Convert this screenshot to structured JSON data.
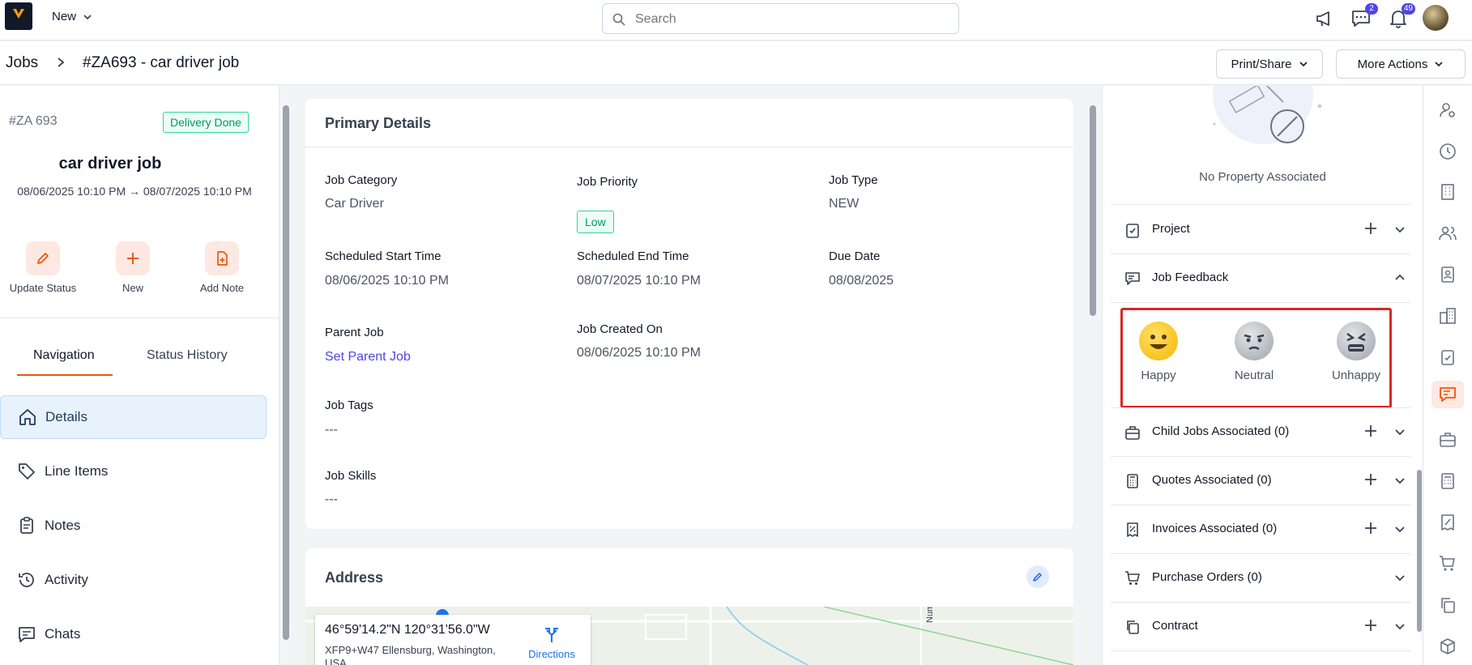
{
  "header": {
    "new_label": "New",
    "search_placeholder": "Search",
    "chat_badge": "2",
    "notification_badge": "49"
  },
  "breadcrumb": {
    "root": "Jobs",
    "current": "#ZA693 - car driver job",
    "print_share_label": "Print/Share",
    "more_actions_label": "More Actions"
  },
  "job": {
    "id": "#ZA 693",
    "status": "Delivery Done",
    "name": "car driver job",
    "dates": "08/06/2025 10:10 PM → 08/07/2025 10:10 PM",
    "actions": [
      "Update Status",
      "New",
      "Add Note"
    ]
  },
  "left_tabs": [
    "Navigation",
    "Status History"
  ],
  "nav_items": [
    "Details",
    "Line Items",
    "Notes",
    "Activity",
    "Chats"
  ],
  "primary": {
    "title": "Primary Details",
    "job_category_label": "Job Category",
    "job_category": "Car Driver",
    "job_priority_label": "Job Priority",
    "job_priority": "Low",
    "job_type_label": "Job Type",
    "job_type": "NEW",
    "sched_start_label": "Scheduled Start Time",
    "sched_start": "08/06/2025 10:10 PM",
    "sched_end_label": "Scheduled End Time",
    "sched_end": "08/07/2025 10:10 PM",
    "due_date_label": "Due Date",
    "due_date": "08/08/2025",
    "parent_job_label": "Parent Job",
    "parent_job_link": "Set Parent Job",
    "created_on_label": "Job Created On",
    "created_on": "08/06/2025 10:10 PM",
    "tags_label": "Job Tags",
    "tags": "---",
    "skills_label": "Job Skills",
    "skills": "---"
  },
  "address": {
    "title": "Address",
    "coords": "46°59'14.2\"N 120°31'56.0\"W",
    "place": "XFP9+W47 Ellensburg, Washington,",
    "place2": "USA",
    "directions": "Directions",
    "road_label": "Number"
  },
  "right": {
    "no_property": "No Property Associated",
    "sections": {
      "project": "Project",
      "feedback": "Job Feedback",
      "child_jobs": "Child Jobs Associated (0)",
      "quotes": "Quotes Associated (0)",
      "invoices": "Invoices Associated (0)",
      "purchase_orders": "Purchase Orders (0)",
      "contract": "Contract"
    },
    "feedback_options": [
      "Happy",
      "Neutral",
      "Unhappy"
    ]
  },
  "colors": {
    "accent": "#ea580c",
    "link": "#4f46e5",
    "success": "#059669",
    "highlight_border": "#dc2626"
  }
}
